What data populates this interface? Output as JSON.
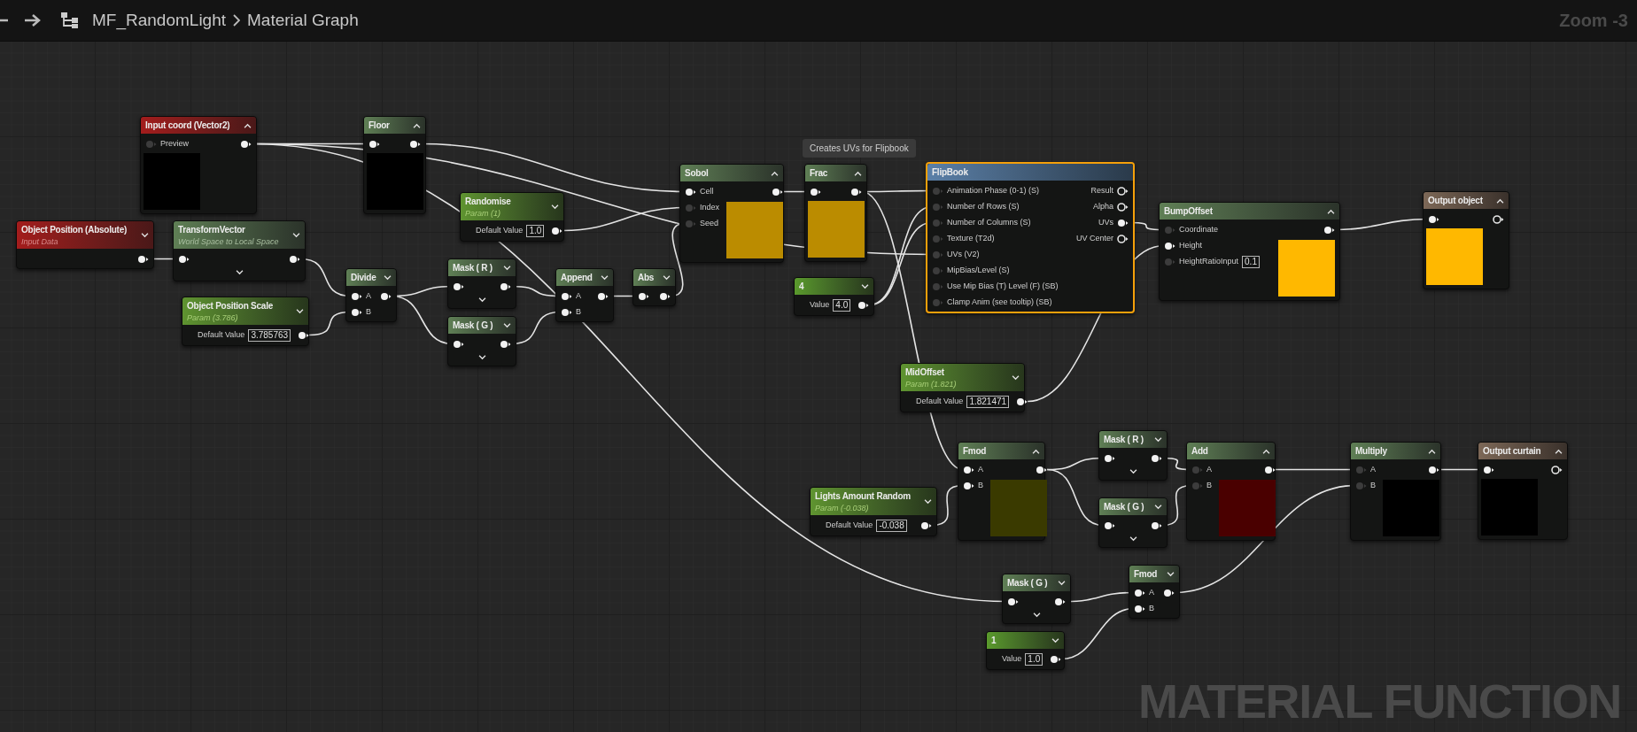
{
  "toolbar": {
    "breadcrumb": [
      "MF_RandomLight",
      "Material Graph"
    ],
    "zoom_label": "Zoom -3"
  },
  "comment": "Creates UVs for Flipbook",
  "graph_type_label": "MATERIAL FUNCTION",
  "nodes": [
    {
      "title": "Input coord (Vector2)",
      "kind": "input",
      "selected": false,
      "preview_expanded": true,
      "inputs": [
        {
          "label": "Preview",
          "connected": false
        }
      ],
      "outputs": [
        {
          "connected": true
        }
      ],
      "color": "#000000"
    },
    {
      "title": "Floor",
      "kind": "function",
      "selected": false,
      "preview_expanded": true,
      "inputs": [
        {
          "connected": true
        }
      ],
      "outputs": [
        {
          "connected": true
        }
      ],
      "color": "#000000"
    },
    {
      "title": "Object Position  (Absolute)",
      "subtitle": "Input Data",
      "kind": "input",
      "selected": false,
      "preview_expanded": false,
      "outputs": [
        {
          "connected": true
        }
      ]
    },
    {
      "title": "TransformVector",
      "subtitle": "World Space to Local Space",
      "kind": "function",
      "selected": false,
      "preview_expanded": false,
      "inputs": [
        {
          "connected": true
        }
      ],
      "outputs": [
        {
          "connected": true
        }
      ],
      "advanced_pins": true
    },
    {
      "title": "Randomise",
      "subtitle": "Param (1)",
      "kind": "param",
      "selected": false,
      "preview_expanded": false,
      "value": {
        "label": "Default Value",
        "value": "1.0"
      },
      "outputs": [
        {
          "connected": true
        }
      ]
    },
    {
      "title": "Object Position Scale",
      "subtitle": "Param (3.786)",
      "kind": "param",
      "selected": false,
      "preview_expanded": false,
      "value": {
        "label": "Default Value",
        "value": "3.785763"
      },
      "outputs": [
        {
          "connected": true
        }
      ]
    },
    {
      "title": "Divide",
      "kind": "function",
      "selected": false,
      "preview_expanded": false,
      "inputs": [
        {
          "label": "A",
          "connected": true
        },
        {
          "label": "B",
          "connected": true
        }
      ],
      "outputs": [
        {
          "connected": true
        }
      ]
    },
    {
      "title": "Mask ( R )",
      "kind": "function",
      "selected": false,
      "preview_expanded": false,
      "inputs": [
        {
          "connected": true
        }
      ],
      "outputs": [
        {
          "connected": true
        }
      ],
      "advanced_pins": true
    },
    {
      "title": "Mask ( G )",
      "kind": "function",
      "selected": false,
      "preview_expanded": false,
      "inputs": [
        {
          "connected": true
        }
      ],
      "outputs": [
        {
          "connected": true
        }
      ],
      "advanced_pins": true
    },
    {
      "title": "Append",
      "kind": "function",
      "selected": false,
      "preview_expanded": false,
      "inputs": [
        {
          "label": "A",
          "connected": true
        },
        {
          "label": "B",
          "connected": true
        }
      ],
      "outputs": [
        {
          "connected": true
        }
      ]
    },
    {
      "title": "Abs",
      "kind": "function",
      "selected": false,
      "preview_expanded": false,
      "inputs": [
        {
          "connected": true
        }
      ],
      "outputs": [
        {
          "connected": true
        }
      ]
    },
    {
      "title": "Sobol",
      "kind": "function",
      "selected": false,
      "preview_expanded": true,
      "inputs": [
        {
          "label": "Cell",
          "connected": true
        },
        {
          "label": "Index",
          "connected": false
        },
        {
          "label": "Seed",
          "connected": false
        }
      ],
      "outputs": [
        {
          "connected": true
        }
      ],
      "color": "#bb8c00"
    },
    {
      "title": "Frac",
      "kind": "function",
      "selected": false,
      "preview_expanded": true,
      "inputs": [
        {
          "connected": true
        }
      ],
      "outputs": [
        {
          "connected": true
        }
      ],
      "color": "#bb8c00"
    },
    {
      "title": "4",
      "kind": "constant",
      "selected": false,
      "preview_expanded": false,
      "value": {
        "label": "Value",
        "value": "4.0"
      },
      "outputs": [
        {
          "connected": true
        }
      ]
    },
    {
      "title": "FlipBook",
      "kind": "flipbook",
      "selected": true,
      "inputs": [
        {
          "label": "Animation  Phase (0-1) (S)",
          "connected": false
        },
        {
          "label": "Number of Rows (S)",
          "connected": false
        },
        {
          "label": "Number of Columns (S)",
          "connected": false
        },
        {
          "label": "Texture (T2d)",
          "connected": false
        },
        {
          "label": "UVs (V2)",
          "connected": false
        },
        {
          "label": "MipBias/Level (S)",
          "connected": false
        },
        {
          "label": "Use Mip Bias (T) Level (F) (SB)",
          "connected": false
        },
        {
          "label": "Clamp Anim (see tooltip) (SB)",
          "connected": false
        }
      ],
      "outputs": [
        {
          "label": "Result",
          "connected": false
        },
        {
          "label": "Alpha",
          "connected": false
        },
        {
          "label": "UVs",
          "connected": true
        },
        {
          "label": "UV Center",
          "connected": false
        }
      ]
    },
    {
      "title": "BumpOffset",
      "kind": "function",
      "selected": false,
      "preview_expanded": true,
      "inputs": [
        {
          "label": "Coordinate",
          "connected": false
        },
        {
          "label": "Height",
          "connected": true
        },
        {
          "label": "HeightRatioInput",
          "connected": false,
          "value": "0.1"
        }
      ],
      "outputs": [
        {
          "connected": true
        }
      ],
      "color": "#ffb800"
    },
    {
      "title": "Output object",
      "kind": "output",
      "selected": false,
      "preview_expanded": true,
      "inputs": [
        {
          "connected": true
        }
      ],
      "outputs": [
        {
          "connected": false
        }
      ],
      "color": "#ffb800"
    },
    {
      "title": "MidOffset",
      "subtitle": "Param (1.821)",
      "kind": "param",
      "selected": false,
      "preview_expanded": false,
      "value": {
        "label": "Default Value",
        "value": "1.821471"
      },
      "outputs": [
        {
          "connected": true
        }
      ]
    },
    {
      "title": "Fmod",
      "kind": "function",
      "selected": false,
      "preview_expanded": true,
      "inputs": [
        {
          "label": "A",
          "connected": true
        },
        {
          "label": "B",
          "connected": true
        }
      ],
      "outputs": [
        {
          "connected": true
        }
      ],
      "color": "#3a3a00"
    },
    {
      "title": "Mask ( R )",
      "kind": "function",
      "selected": false,
      "preview_expanded": false,
      "inputs": [
        {
          "connected": true
        }
      ],
      "outputs": [
        {
          "connected": true
        }
      ],
      "advanced_pins": true
    },
    {
      "title": "Mask ( G )",
      "kind": "function",
      "selected": false,
      "preview_expanded": false,
      "inputs": [
        {
          "connected": true
        }
      ],
      "outputs": [
        {
          "connected": true
        }
      ],
      "advanced_pins": true
    },
    {
      "title": "Add",
      "kind": "function",
      "selected": false,
      "preview_expanded": true,
      "inputs": [
        {
          "label": "A",
          "connected": false
        },
        {
          "label": "B",
          "connected": false
        }
      ],
      "outputs": [
        {
          "connected": true
        }
      ],
      "color": "#4a0000"
    },
    {
      "title": "Multiply",
      "kind": "function",
      "selected": false,
      "preview_expanded": true,
      "inputs": [
        {
          "label": "A",
          "connected": false
        },
        {
          "label": "B",
          "connected": false
        }
      ],
      "outputs": [
        {
          "connected": true
        }
      ],
      "color": "#000000"
    },
    {
      "title": "Output curtain",
      "kind": "output",
      "selected": false,
      "preview_expanded": true,
      "inputs": [
        {
          "connected": true
        }
      ],
      "outputs": [
        {
          "connected": false
        }
      ],
      "color": "#000000"
    },
    {
      "title": "Lights Amount Random",
      "subtitle": "Param (-0.038)",
      "kind": "param",
      "selected": false,
      "preview_expanded": false,
      "value": {
        "label": "Default Value",
        "value": "-0.038"
      },
      "outputs": [
        {
          "connected": true
        }
      ]
    },
    {
      "title": "Mask ( G )",
      "kind": "function",
      "selected": false,
      "preview_expanded": false,
      "inputs": [
        {
          "connected": true
        }
      ],
      "outputs": [
        {
          "connected": true
        }
      ],
      "advanced_pins": true
    },
    {
      "title": "Fmod",
      "kind": "function",
      "selected": false,
      "preview_expanded": false,
      "inputs": [
        {
          "label": "A",
          "connected": true
        },
        {
          "label": "B",
          "connected": true
        }
      ],
      "outputs": [
        {
          "connected": true
        }
      ]
    },
    {
      "title": "1",
      "kind": "constant",
      "selected": false,
      "preview_expanded": false,
      "value": {
        "label": "Value",
        "value": "1.0"
      },
      "outputs": [
        {
          "connected": true
        }
      ]
    }
  ]
}
